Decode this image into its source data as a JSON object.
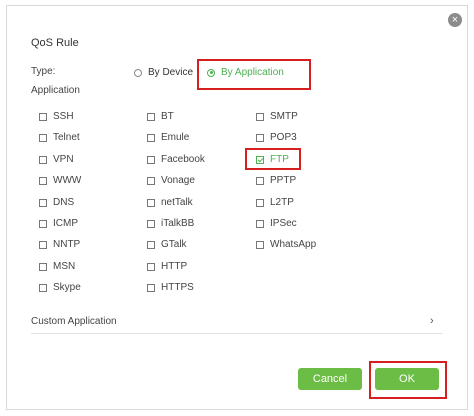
{
  "dialog": {
    "close_symbol": "×",
    "title": "QoS Rule",
    "type_label": "Type:",
    "type_options": [
      "By Device",
      "By Application"
    ],
    "selected_type": "By Application",
    "application_label": "Application",
    "columns": [
      [
        "SSH",
        "Telnet",
        "VPN",
        "WWW",
        "DNS",
        "ICMP",
        "NNTP",
        "MSN",
        "Skype"
      ],
      [
        "BT",
        "Emule",
        "Facebook",
        "Vonage",
        "netTalk",
        "iTalkBB",
        "GTalk",
        "HTTP",
        "HTTPS"
      ],
      [
        "SMTP",
        "POP3",
        "FTP",
        "PPTP",
        "L2TP",
        "IPSec",
        "WhatsApp"
      ]
    ],
    "checked_apps": [
      "FTP"
    ],
    "custom_application_label": "Custom Application",
    "custom_chevron": "›",
    "cancel_label": "Cancel",
    "ok_label": "OK"
  },
  "colors": {
    "accent_green": "#6cbd45",
    "highlight_red": "#d62020"
  }
}
